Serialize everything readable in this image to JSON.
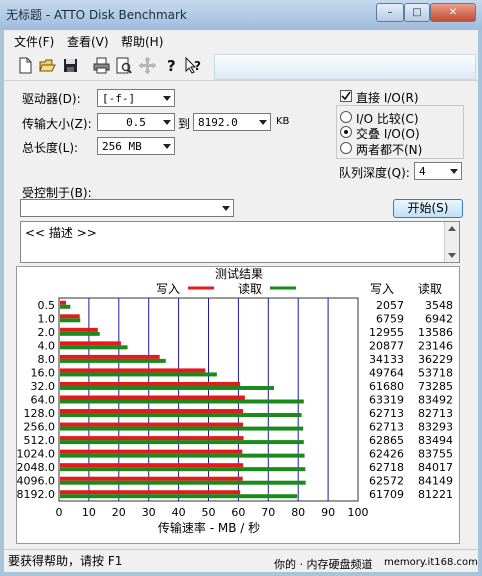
{
  "window": {
    "title": "无标题 - ATTO Disk Benchmark",
    "controls": [
      "–",
      "□",
      "✕"
    ]
  },
  "menu": {
    "items": [
      "文件(F)",
      "查看(V)",
      "帮助(H)"
    ]
  },
  "toolbar": {
    "icons": [
      "new-file-icon",
      "open-folder-icon",
      "save-icon",
      "print-icon",
      "print-preview-icon",
      "move-icon",
      "help-icon",
      "context-help-icon"
    ]
  },
  "form": {
    "drive_label": "驱动器(D):",
    "drive_value": "[-f-]",
    "transfer_label": "传输大小(Z):",
    "transfer_from": "0.5",
    "to_label": "到",
    "transfer_to": "8192.0",
    "unit_kb": "KB",
    "length_label": "总长度(L):",
    "length_value": "256 MB",
    "controlled_label": "受控制于(B):",
    "controlled_value": "",
    "direct_io_label": "直接 I/O(R)",
    "direct_io_checked": true,
    "radio_io_compare": "I/O 比较(C)",
    "radio_overlapped": "交叠 I/O(O)",
    "radio_neither": "两者都不(N)",
    "selected_radio": "overlapped",
    "queue_label": "队列深度(Q):",
    "queue_value": "4",
    "start_button": "开始(S)",
    "description": "<< 描述 >>"
  },
  "results": {
    "title": "测试结果",
    "legend_write": "写入",
    "legend_read": "读取",
    "col_write": "写入",
    "col_read": "读取",
    "xlabel": "传输速率 - MB / 秒",
    "write_color": "#e41a1c",
    "read_color": "#1a8a1a"
  },
  "status": {
    "help_text": "要获得帮助，请按 F1",
    "channel": "你的 · 内存硬盘频道",
    "watermark": "memory.it168.com"
  },
  "chart_data": {
    "type": "bar",
    "orientation": "horizontal",
    "categories": [
      "0.5",
      "1.0",
      "2.0",
      "4.0",
      "8.0",
      "16.0",
      "32.0",
      "64.0",
      "128.0",
      "256.0",
      "512.0",
      "1024.0",
      "2048.0",
      "4096.0",
      "8192.0"
    ],
    "series": [
      {
        "name": "写入",
        "values": [
          2057,
          6759,
          12955,
          20877,
          34133,
          49764,
          61680,
          63319,
          62713,
          62713,
          62865,
          62426,
          62718,
          62572,
          61709
        ]
      },
      {
        "name": "读取",
        "values": [
          3548,
          6942,
          13586,
          23146,
          36229,
          53718,
          73285,
          83492,
          82713,
          83293,
          83494,
          83755,
          84017,
          84149,
          81221
        ]
      }
    ],
    "xticks": [
      "0",
      "10",
      "20",
      "30",
      "40",
      "50",
      "60",
      "70",
      "80",
      "90",
      "100"
    ],
    "xlim": [
      0,
      100
    ],
    "xlabel": "传输速率 - MB / 秒",
    "title": "测试结果"
  }
}
